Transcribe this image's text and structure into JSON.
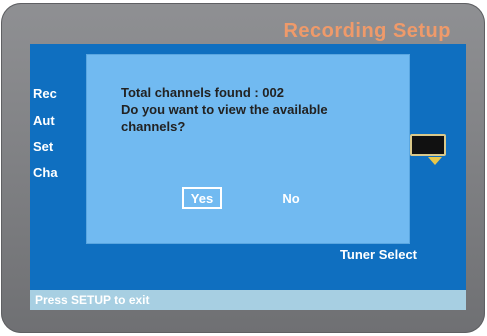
{
  "title": "Recording Setup",
  "menu": [
    {
      "label": "Rec"
    },
    {
      "label": "Aut"
    },
    {
      "label": "Set"
    },
    {
      "label": "Cha"
    }
  ],
  "tuner_select": "Tuner Select",
  "status": "Press SETUP to exit",
  "dialog": {
    "line1": "Total channels found : 002",
    "line2": "Do you want to view  the available",
    "line3": "channels?",
    "yes": "Yes",
    "no": "No"
  },
  "colors": {
    "screen": "#0f6fc0",
    "dialog": "#71baf1",
    "title": "#ef9a6a",
    "statusbar": "#a7cfe2",
    "bezel": "#7f8083"
  }
}
